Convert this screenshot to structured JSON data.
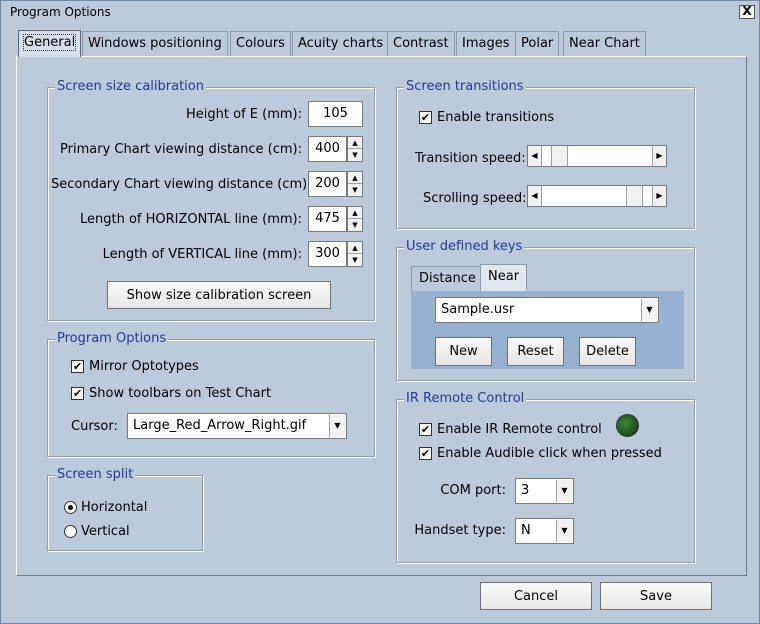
{
  "window": {
    "title": "Program Options",
    "close_glyph": "X"
  },
  "tabs": [
    {
      "label": "General"
    },
    {
      "label": "Windows positioning"
    },
    {
      "label": "Colours"
    },
    {
      "label": "Acuity charts"
    },
    {
      "label": "Contrast"
    },
    {
      "label": "Images"
    },
    {
      "label": "Polar"
    },
    {
      "label": "Near Chart"
    }
  ],
  "screen_size_calibration": {
    "title": "Screen size calibration",
    "fields": [
      {
        "label": "Height of E (mm):",
        "value": "105"
      },
      {
        "label": "Primary Chart viewing distance (cm):",
        "value": "400"
      },
      {
        "label": "Secondary Chart viewing distance (cm):",
        "value": "200"
      },
      {
        "label": "Length of HORIZONTAL line (mm):",
        "value": "475"
      },
      {
        "label": "Length of VERTICAL line (mm):",
        "value": "300"
      }
    ],
    "button": "Show size calibration screen"
  },
  "program_options": {
    "title": "Program Options",
    "mirror_label": "Mirror Optotypes",
    "mirror_checked": true,
    "toolbars_label": "Show toolbars on Test Chart",
    "toolbars_checked": true,
    "cursor_label": "Cursor:",
    "cursor_value": "Large_Red_Arrow_Right.gif"
  },
  "screen_split": {
    "title": "Screen split",
    "horizontal_label": "Horizontal",
    "vertical_label": "Vertical",
    "selected": "Horizontal"
  },
  "screen_transitions": {
    "title": "Screen transitions",
    "enable_label": "Enable transitions",
    "enable_checked": true,
    "transition_speed_label": "Transition speed:",
    "transition_speed_level": 0.1,
    "scrolling_speed_label": "Scrolling speed:",
    "scrolling_speed_level": 0.9
  },
  "user_defined_keys": {
    "title": "User defined keys",
    "tabs": [
      "Distance",
      "Near"
    ],
    "active_tab": "Near",
    "file_value": "Sample.usr",
    "new_label": "New",
    "reset_label": "Reset",
    "delete_label": "Delete"
  },
  "ir_remote": {
    "title": "IR Remote Control",
    "enable_label": "Enable IR Remote control",
    "enable_checked": true,
    "audible_label": "Enable Audible click when pressed",
    "audible_checked": true,
    "com_label": "COM port:",
    "com_value": "3",
    "handset_label": "Handset type:",
    "handset_value": "N",
    "led_color": "#2e6b2b"
  },
  "footer": {
    "cancel_label": "Cancel",
    "save_label": "Save"
  },
  "glyphs": {
    "check": "✔",
    "spin_up": "▲",
    "spin_down": "▼",
    "combo_arrow": "▼",
    "left_arrow": "◀",
    "right_arrow": "▶"
  }
}
